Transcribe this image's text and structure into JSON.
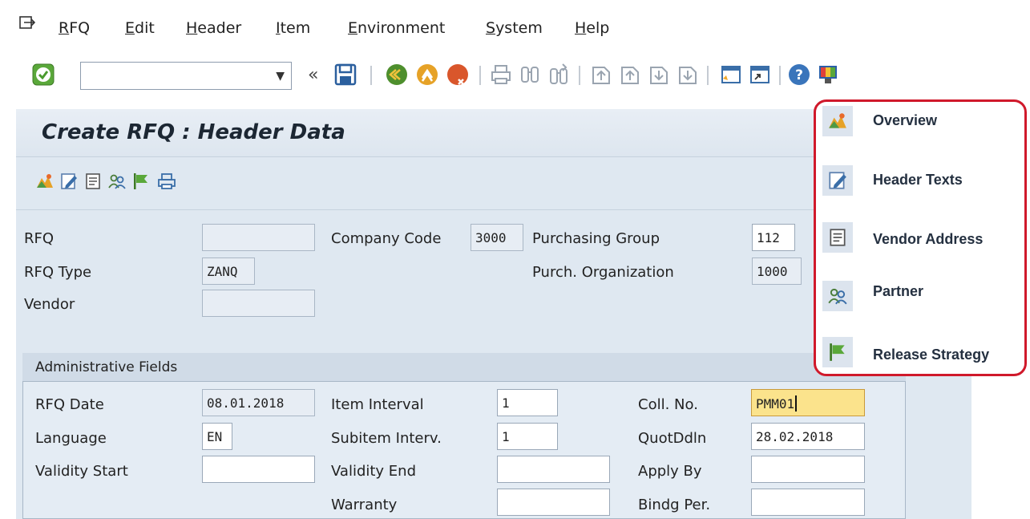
{
  "menubar": {
    "items": [
      "RFQ",
      "Edit",
      "Header",
      "Item",
      "Environment",
      "System",
      "Help"
    ]
  },
  "toolbar": {
    "command_field_value": "",
    "icons": [
      "enter-icon",
      "back-icon",
      "save-icon",
      "exit-icon",
      "cancel-icon",
      "print-icon",
      "find-icon",
      "find-next-icon",
      "first-page-icon",
      "previous-page-icon",
      "next-page-icon",
      "last-page-icon",
      "new-session-icon",
      "shortcut-icon",
      "help-icon",
      "customize-layout-icon"
    ]
  },
  "header": {
    "title": "Create RFQ : Header Data"
  },
  "app_toolbar": {
    "icons": [
      "overview-icon",
      "header-texts-icon",
      "vendor-address-icon",
      "partner-icon",
      "release-strategy-icon",
      "print-preview-icon"
    ]
  },
  "form": {
    "rfq_label": "RFQ",
    "rfq_value": "",
    "rfq_type_label": "RFQ Type",
    "rfq_type_value": "ZANQ",
    "vendor_label": "Vendor",
    "vendor_value": "",
    "company_code_label": "Company Code",
    "company_code_value": "3000",
    "purchasing_group_label": "Purchasing Group",
    "purchasing_group_value": "112",
    "purch_org_label": "Purch. Organization",
    "purch_org_value": "1000"
  },
  "admin": {
    "title": "Administrative Fields",
    "rfq_date_label": "RFQ Date",
    "rfq_date_value": "08.01.2018",
    "language_label": "Language",
    "language_value": "EN",
    "validity_start_label": "Validity Start",
    "validity_start_value": "",
    "item_interval_label": "Item Interval",
    "item_interval_value": "1",
    "subitem_interval_label": "Subitem Interv.",
    "subitem_interval_value": "1",
    "validity_end_label": "Validity End",
    "validity_end_value": "",
    "warranty_label": "Warranty",
    "warranty_value": "",
    "coll_no_label": "Coll. No.",
    "coll_no_value": "PMM01",
    "quot_ddln_label": "QuotDdln",
    "quot_ddln_value": "28.02.2018",
    "apply_by_label": "Apply By",
    "apply_by_value": "",
    "bindg_per_label": "Bindg Per.",
    "bindg_per_value": ""
  },
  "popup": {
    "items": [
      {
        "label": "Overview",
        "icon": "overview-icon"
      },
      {
        "label": "Header Texts",
        "icon": "header-texts-icon"
      },
      {
        "label": "Vendor Address",
        "icon": "vendor-address-icon"
      },
      {
        "label": "Partner",
        "icon": "partner-icon"
      },
      {
        "label": "Release Strategy",
        "icon": "release-strategy-icon"
      }
    ]
  },
  "colors": {
    "accent_red": "#d0192b",
    "highlight_field": "#fbe38c",
    "panel_bg": "#dfe8f1"
  }
}
